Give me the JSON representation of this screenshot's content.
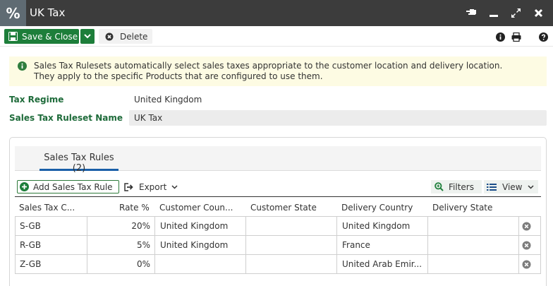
{
  "window": {
    "title": "UK Tax",
    "app_icon_glyph": "%"
  },
  "toolbar": {
    "save_label": "Save & Close",
    "delete_label": "Delete"
  },
  "info": {
    "line1": "Sales Tax Rulesets automatically select sales taxes appropriate to the customer location and delivery location.",
    "line2": "They apply to the specific Products that are configured to use them."
  },
  "form": {
    "tax_regime_label": "Tax Regime",
    "tax_regime_value": "United Kingdom",
    "ruleset_name_label": "Sales Tax Ruleset Name",
    "ruleset_name_value": "UK Tax"
  },
  "tabs": [
    {
      "label": "Sales Tax Rules (2)"
    }
  ],
  "grid": {
    "add_label": "Add Sales Tax Rule",
    "export_label": "Export",
    "filters_label": "Filters",
    "view_label": "View",
    "columns": [
      "Sales Tax C...",
      "Rate %",
      "Customer Coun...",
      "Customer State",
      "Delivery Country",
      "Delivery State"
    ],
    "rows": [
      {
        "code": "S-GB",
        "rate": "20%",
        "customer_country": "United Kingdom",
        "customer_state": "",
        "delivery_country": "United Kingdom",
        "delivery_state": ""
      },
      {
        "code": "R-GB",
        "rate": "5%",
        "customer_country": "United Kingdom",
        "customer_state": "",
        "delivery_country": "France",
        "delivery_state": ""
      },
      {
        "code": "Z-GB",
        "rate": "0%",
        "customer_country": "",
        "customer_state": "",
        "delivery_country": "United Arab Emir...",
        "delivery_state": ""
      }
    ]
  },
  "colors": {
    "accent_green": "#1d7e3a",
    "label_green": "#1e6b3a",
    "tab_blue": "#1a5fa8",
    "titlebar": "#3c3c3c"
  },
  "icons": [
    "percent-icon",
    "pin-icon",
    "minimize-icon",
    "maximize-icon",
    "close-icon",
    "save-icon",
    "chevron-down-icon",
    "delete-icon",
    "info-icon",
    "print-icon",
    "help-icon",
    "add-icon",
    "export-icon",
    "search-icon",
    "list-icon",
    "remove-row-icon"
  ]
}
